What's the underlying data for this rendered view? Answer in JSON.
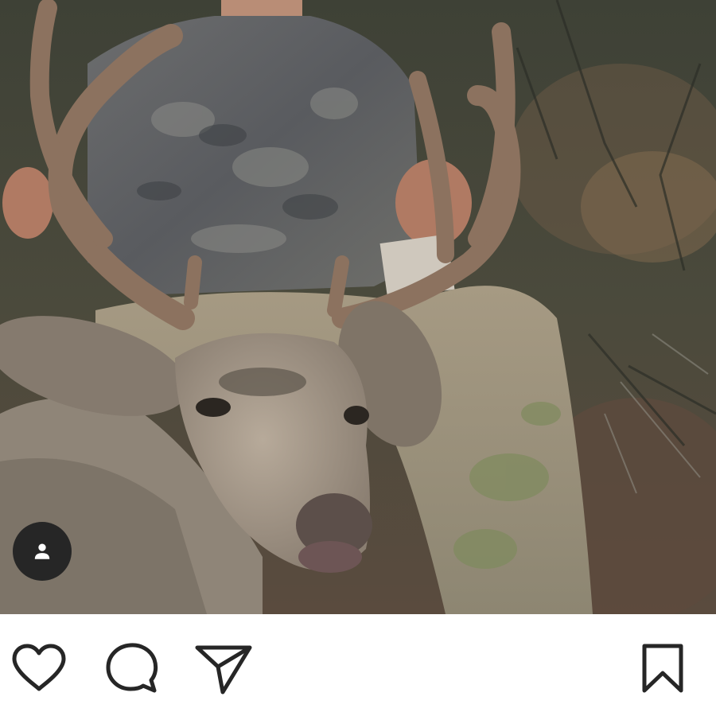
{
  "post": {
    "photo": {
      "subject": "",
      "icon": "photo"
    },
    "user_tag": {
      "icon": "person-icon",
      "color": "#262626"
    },
    "actions": {
      "like": {
        "icon": "heart-icon"
      },
      "comment": {
        "icon": "speech-bubble-icon"
      },
      "share": {
        "icon": "paper-plane-icon"
      },
      "save": {
        "icon": "bookmark-icon"
      }
    },
    "colors": {
      "background": "#ffffff",
      "icon_stroke": "#262626"
    }
  }
}
